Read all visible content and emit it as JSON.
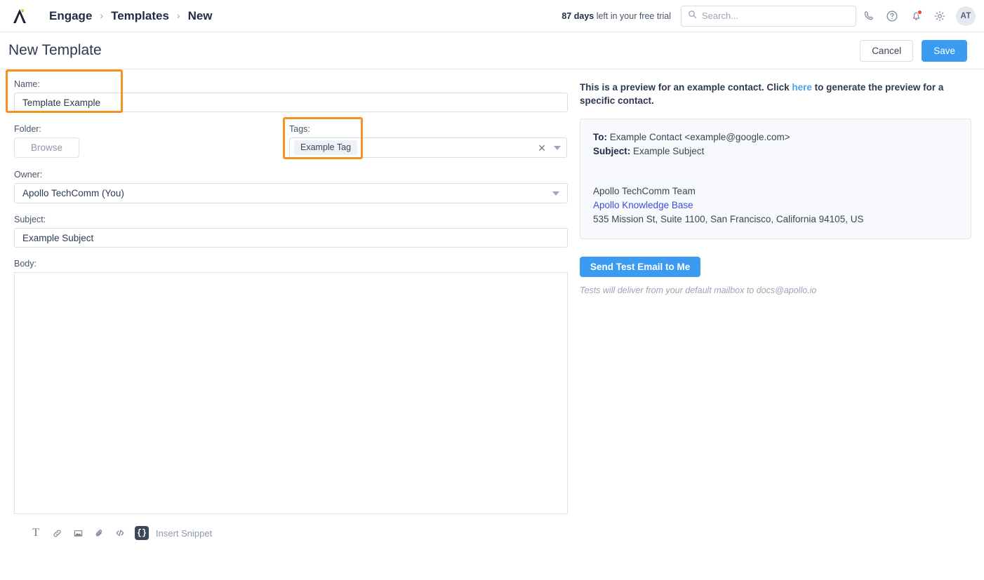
{
  "topnav": {
    "logo_name": "apollo-logo",
    "breadcrumb": [
      "Engage",
      "Templates",
      "New"
    ],
    "separator": "›",
    "trial_days": "87 days",
    "trial_rest": " left in your free trial",
    "search": {
      "placeholder": "Search...",
      "value": ""
    },
    "icons": [
      "phone-icon",
      "help-circle-icon",
      "bell-icon",
      "gear-icon"
    ],
    "avatar_initials": "AT"
  },
  "titlebar": {
    "title": "New Template",
    "cancel_label": "Cancel",
    "save_label": "Save"
  },
  "form": {
    "name": {
      "label": "Name:",
      "value": "Template Example"
    },
    "folder": {
      "label": "Folder:",
      "browse_label": "Browse"
    },
    "tags": {
      "label": "Tags:",
      "chip": "Example Tag",
      "clear_glyph": "✕"
    },
    "owner": {
      "label": "Owner:",
      "value": "Apollo TechComm (You)"
    },
    "subject": {
      "label": "Subject:",
      "value": "Example Subject"
    },
    "body": {
      "label": "Body:",
      "value": ""
    }
  },
  "toolbar": {
    "text_glyph": "T",
    "items": [
      "text-format-icon",
      "link-icon",
      "image-icon",
      "attachment-icon",
      "code-icon"
    ],
    "snippet_glyph": "{}",
    "snippet_label": "Insert Snippet"
  },
  "preview": {
    "note_before": "This is a preview for an example contact. Click ",
    "note_link": "here",
    "note_after": " to generate the preview for a specific contact.",
    "to_label": "To:",
    "to_value": "Example Contact <example@google.com>",
    "subject_label": "Subject:",
    "subject_value": "Example Subject",
    "signature_name": "Apollo TechComm Team",
    "signature_link": "Apollo Knowledge Base",
    "signature_address": "535 Mission St, Suite 1100, San Francisco, California 94105, US",
    "send_button": "Send Test Email to Me",
    "send_note": "Tests will deliver from your default mailbox to docs@apollo.io"
  },
  "colors": {
    "accent_blue": "#3b9bf0",
    "highlight_orange": "#f5911e",
    "link_blue": "#4aa3f0",
    "bell_badge": "#f5403a"
  }
}
